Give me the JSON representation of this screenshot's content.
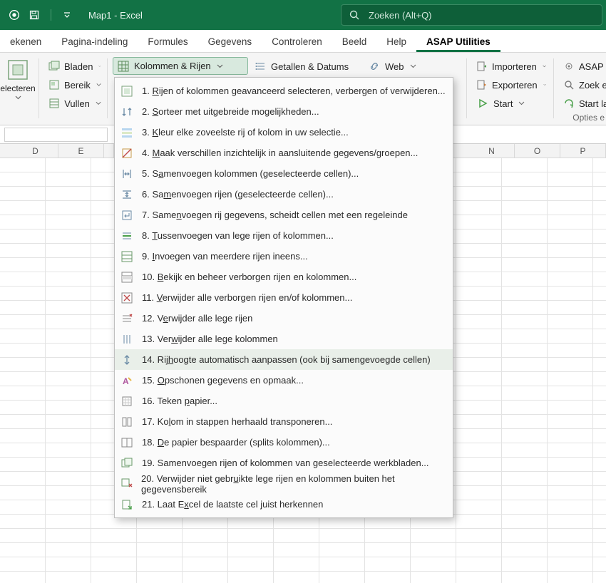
{
  "title": "Map1  -  Excel",
  "search": {
    "placeholder": "Zoeken (Alt+Q)"
  },
  "tabs": {
    "items": [
      {
        "label": "ekenen"
      },
      {
        "label": "Pagina-indeling"
      },
      {
        "label": "Formules"
      },
      {
        "label": "Gegevens"
      },
      {
        "label": "Controleren"
      },
      {
        "label": "Beeld"
      },
      {
        "label": "Help"
      },
      {
        "label": "ASAP Utilities"
      }
    ]
  },
  "ribbon": {
    "selecteren": "electeren",
    "bladen": "Bladen",
    "bereik": "Bereik",
    "vullen": "Vullen",
    "kolommen": "Kolommen & Rijen",
    "getallen": "Getallen & Datums",
    "web": "Web",
    "importeren": "Importeren",
    "exporteren": "Exporteren",
    "start": "Start",
    "asaput": "ASAP Ut",
    "zoeken": "Zoek en",
    "startlaa": "Start laa",
    "opties": "Opties e"
  },
  "menu": {
    "items": [
      {
        "n": "1",
        "label_html": "1. <u>R</u>ijen of kolommen geavanceerd selecteren, verbergen of verwijderen..."
      },
      {
        "n": "2",
        "label_html": "2. <u>S</u>orteer met uitgebreide mogelijkheden..."
      },
      {
        "n": "3",
        "label_html": "3. <u>K</u>leur elke zoveelste rij of kolom in uw selectie..."
      },
      {
        "n": "4",
        "label_html": "4. <u>M</u>aak verschillen inzichtelijk in aansluitende gegevens/groepen..."
      },
      {
        "n": "5",
        "label_html": "5. S<u>a</u>menvoegen kolommen (geselecteerde cellen)..."
      },
      {
        "n": "6",
        "label_html": "6. Sa<u>m</u>envoegen rijen (geselecteerde cellen)..."
      },
      {
        "n": "7",
        "label_html": "7. Same<u>n</u>voegen rij gegevens, scheidt cellen met een regeleinde"
      },
      {
        "n": "8",
        "label_html": "8. <u>T</u>ussenvoegen van lege rijen of kolommen..."
      },
      {
        "n": "9",
        "label_html": "9. <u>I</u>nvoegen van meerdere rijen ineens..."
      },
      {
        "n": "10",
        "label_html": "10. <u>B</u>ekijk en beheer verborgen rijen en kolommen..."
      },
      {
        "n": "11",
        "label_html": "11. <u>V</u>erwijder alle verborgen rijen en/of kolommen..."
      },
      {
        "n": "12",
        "label_html": "12. V<u>e</u>rwijder alle lege rijen"
      },
      {
        "n": "13",
        "label_html": "13. Ver<u>w</u>ijder alle lege kolommen"
      },
      {
        "n": "14",
        "label_html": "14. Rij<u>h</u>oogte automatisch aanpassen (ook bij samengevoegde cellen)"
      },
      {
        "n": "15",
        "label_html": "15. <u>O</u>pschonen gegevens en opmaak..."
      },
      {
        "n": "16",
        "label_html": "16. Teken <u>p</u>apier..."
      },
      {
        "n": "17",
        "label_html": "17. Ko<u>l</u>om in stappen herhaald transponeren..."
      },
      {
        "n": "18",
        "label_html": "18. <u>D</u>e papier bespaarder (splits kolommen)..."
      },
      {
        "n": "19",
        "label_html": "19. Samenvoe<u>g</u>en rijen of kolommen van geselecteerde werkbladen..."
      },
      {
        "n": "20",
        "label_html": "20. Verwijder niet gebr<u>u</u>ikte lege rijen en kolommen buiten het gegevensbereik"
      },
      {
        "n": "21",
        "label_html": "21. Laat E<u>x</u>cel de laatste cel juist herkennen"
      }
    ]
  },
  "columns": [
    "D",
    "E",
    "N",
    "O",
    "P"
  ]
}
